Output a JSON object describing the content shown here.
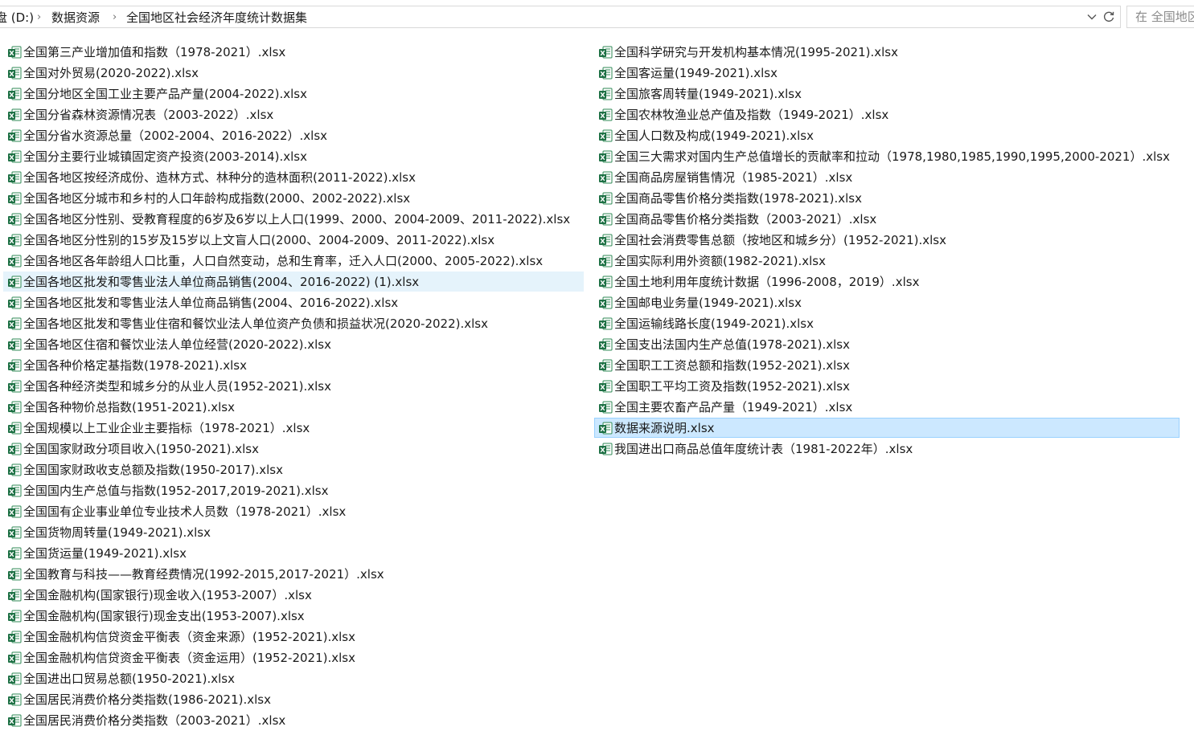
{
  "address": {
    "crumbs": [
      "盘 (D:)",
      "数据资源",
      "全国地区社会经济年度统计数据集"
    ],
    "dropdown_icon": "chevron-down-icon",
    "refresh_icon": "refresh-icon"
  },
  "search": {
    "placeholder": "在 全国地区社会经济年度统计数据集 中搜索"
  },
  "colors": {
    "selected_bg": "#cce8ff",
    "selected_border": "#99d1ff",
    "hover_bg": "#e5f3fb",
    "excel_green": "#1d7044"
  },
  "files": {
    "left": [
      "全国第三产业增加值和指数（1978-2021）.xlsx",
      "全国对外贸易(2020-2022).xlsx",
      "全国分地区全国工业主要产品产量(2004-2022).xlsx",
      "全国分省森林资源情况表（2003-2022）.xlsx",
      "全国分省水资源总量（2002-2004、2016-2022）.xlsx",
      "全国分主要行业城镇固定资产投资(2003-2014).xlsx",
      "全国各地区按经济成份、造林方式、林种分的造林面积(2011-2022).xlsx",
      "全国各地区分城市和乡村的人口年龄构成指数(2000、2002-2022).xlsx",
      "全国各地区分性别、受教育程度的6岁及6岁以上人口(1999、2000、2004-2009、2011-2022).xlsx",
      "全国各地区分性别的15岁及15岁以上文盲人口(2000、2004-2009、2011-2022).xlsx",
      "全国各地区各年龄组人口比重，人口自然变动，总和生育率，迁入人口(2000、2005-2022).xlsx",
      "全国各地区批发和零售业法人单位商品销售(2004、2016-2022) (1).xlsx",
      "全国各地区批发和零售业法人单位商品销售(2004、2016-2022).xlsx",
      "全国各地区批发和零售业住宿和餐饮业法人单位资产负债和损益状况(2020-2022).xlsx",
      "全国各地区住宿和餐饮业法人单位经营(2020-2022).xlsx",
      "全国各种价格定基指数(1978-2021).xlsx",
      "全国各种经济类型和城乡分的从业人员(1952-2021).xlsx",
      "全国各种物价总指数(1951-2021).xlsx",
      "全国规模以上工业企业主要指标（1978-2021）.xlsx",
      "全国国家财政分项目收入(1950-2021).xlsx",
      "全国国家财政收支总额及指数(1950-2017).xlsx",
      "全国国内生产总值与指数(1952-2017,2019-2021).xlsx",
      "全国国有企业事业单位专业技术人员数（1978-2021）.xlsx",
      "全国货物周转量(1949-2021).xlsx",
      "全国货运量(1949-2021).xlsx",
      "全国教育与科技——教育经费情况(1992-2015,2017-2021）.xlsx",
      "全国金融机构(国家银行)现金收入(1953-2007）.xlsx",
      "全国金融机构(国家银行)现金支出(1953-2007).xlsx",
      "全国金融机构信贷资金平衡表（资金来源）(1952-2021).xlsx",
      "全国金融机构信贷资金平衡表（资金运用）(1952-2021).xlsx",
      "全国进出口贸易总额(1950-2021).xlsx",
      "全国居民消费价格分类指数(1986-2021).xlsx",
      "全国居民消费价格分类指数（2003-2021）.xlsx"
    ],
    "right": [
      "全国科学研究与开发机构基本情况(1995-2021).xlsx",
      "全国客运量(1949-2021).xlsx",
      "全国旅客周转量(1949-2021).xlsx",
      "全国农林牧渔业总产值及指数（1949-2021）.xlsx",
      "全国人口数及构成(1949-2021).xlsx",
      "全国三大需求对国内生产总值增长的贡献率和拉动（1978,1980,1985,1990,1995,2000-2021）.xlsx",
      "全国商品房屋销售情况（1985-2021）.xlsx",
      "全国商品零售价格分类指数(1978-2021).xlsx",
      "全国商品零售价格分类指数（2003-2021）.xlsx",
      "全国社会消费零售总额（按地区和城乡分）(1952-2021).xlsx",
      "全国实际利用外资额(1982-2021).xlsx",
      "全国土地利用年度统计数据（1996-2008，2019）.xlsx",
      "全国邮电业务量(1949-2021).xlsx",
      "全国运输线路长度(1949-2021).xlsx",
      "全国支出法国内生产总值(1978-2021).xlsx",
      "全国职工工资总额和指数(1952-2021).xlsx",
      "全国职工平均工资及指数(1952-2021).xlsx",
      "全国主要农畜产品产量（1949-2021）.xlsx",
      "数据来源说明.xlsx",
      "我国进出口商品总值年度统计表（1981-2022年）.xlsx"
    ]
  }
}
